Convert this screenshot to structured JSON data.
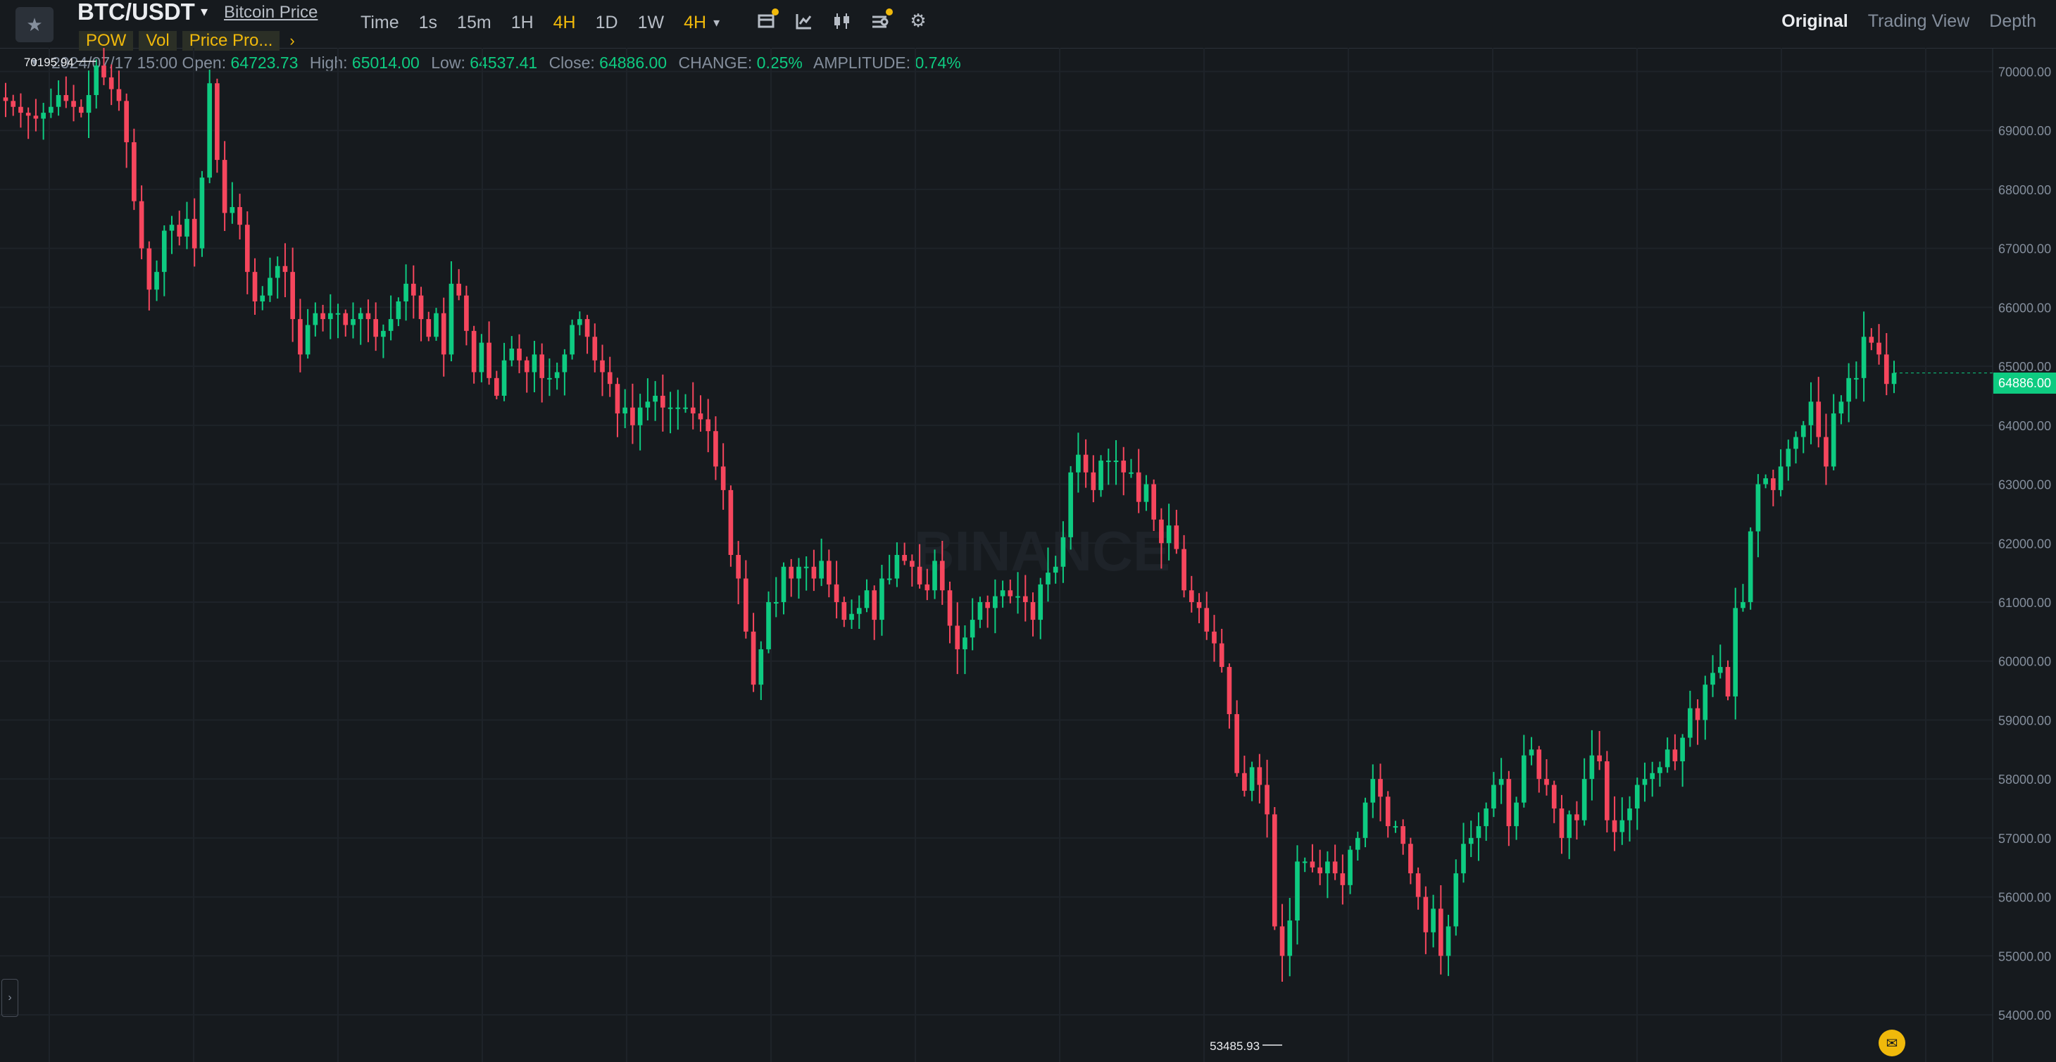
{
  "header": {
    "symbol": "BTC/USDT",
    "price_link": "Bitcoin Price",
    "indicators": [
      "POW",
      "Vol",
      "Price Pro..."
    ],
    "intervals": [
      {
        "label": "Time",
        "active": false
      },
      {
        "label": "1s",
        "active": false
      },
      {
        "label": "15m",
        "active": false
      },
      {
        "label": "1H",
        "active": false
      },
      {
        "label": "4H",
        "active": true
      },
      {
        "label": "1D",
        "active": false
      },
      {
        "label": "1W",
        "active": false
      },
      {
        "label": "4H",
        "active": true
      }
    ],
    "views": [
      "Original",
      "Trading View",
      "Depth"
    ],
    "active_view": "Original",
    "tool_icons": [
      "calendar-icon",
      "indicator-chart-icon",
      "candlestick-icon",
      "settings-list-icon",
      "gear-icon"
    ]
  },
  "ohlc": {
    "datetime": "2024/07/17 15:00",
    "open_label": "Open:",
    "open": "64723.73",
    "high_label": "High:",
    "high": "65014.00",
    "low_label": "Low:",
    "low": "64537.41",
    "close_label": "Close:",
    "close": "64886.00",
    "change_label": "CHANGE:",
    "change": "0.25%",
    "amplitude_label": "AMPLITUDE:",
    "amplitude": "0.74%"
  },
  "watermark": "BINANCE",
  "colors": {
    "up": "#0ecb81",
    "down": "#f6465d",
    "accent": "#f0b90b",
    "bg": "#161a1e"
  },
  "chart_data": {
    "type": "candlestick",
    "y_ticks": [
      "70000.00",
      "69000.00",
      "68000.00",
      "67000.00",
      "66000.00",
      "65000.00",
      "64000.00",
      "63000.00",
      "62000.00",
      "61000.00",
      "60000.00",
      "59000.00",
      "58000.00",
      "57000.00",
      "56000.00",
      "55000.00",
      "54000.00"
    ],
    "ylim": [
      53200,
      70400
    ],
    "current_price": "64886.00",
    "max_label": "70195.94",
    "min_label": "53485.93",
    "closes": [
      69500,
      69400,
      69300,
      69250,
      69200,
      69300,
      69400,
      69600,
      69500,
      69400,
      69300,
      69600,
      70100,
      69900,
      69700,
      69500,
      68800,
      67800,
      67000,
      66300,
      66600,
      67300,
      67400,
      67200,
      67500,
      67000,
      68200,
      69800,
      68500,
      67600,
      67700,
      67400,
      66600,
      66100,
      66200,
      66500,
      66700,
      66600,
      65800,
      65200,
      65700,
      65900,
      65800,
      65900,
      65900,
      65700,
      65800,
      65900,
      65800,
      65500,
      65600,
      65800,
      66100,
      66400,
      66200,
      65800,
      65500,
      65900,
      65200,
      66400,
      66200,
      65600,
      64900,
      65400,
      64800,
      64500,
      65100,
      65300,
      65100,
      64900,
      65200,
      64800,
      64800,
      64900,
      65200,
      65700,
      65800,
      65500,
      65100,
      64900,
      64700,
      64200,
      64300,
      64000,
      64300,
      64400,
      64500,
      64300,
      64300,
      64300,
      64300,
      64200,
      64100,
      63900,
      63300,
      62900,
      61800,
      61400,
      60500,
      59600,
      60200,
      61000,
      61000,
      61600,
      61400,
      61600,
      61600,
      61400,
      61700,
      61300,
      61000,
      60700,
      60800,
      60900,
      61200,
      60700,
      61400,
      61400,
      61800,
      61700,
      61600,
      61300,
      61200,
      61700,
      61200,
      60600,
      60200,
      60400,
      60700,
      61000,
      60900,
      61100,
      61200,
      61100,
      61100,
      61000,
      60700,
      61300,
      61500,
      61600,
      62100,
      63200,
      63500,
      63200,
      62900,
      63400,
      63400,
      63400,
      63200,
      63200,
      62700,
      63000,
      62400,
      62000,
      62300,
      61900,
      61200,
      61000,
      60900,
      60500,
      60300,
      59900,
      59100,
      58100,
      57800,
      58200,
      57900,
      57400,
      55500,
      55000,
      55600,
      56600,
      56600,
      56500,
      56400,
      56600,
      56400,
      56200,
      56800,
      57000,
      57600,
      58000,
      57700,
      57200,
      57200,
      56900,
      56400,
      56000,
      55400,
      55800,
      55000,
      55500,
      56400,
      56900,
      57000,
      57200,
      57500,
      57900,
      58000,
      57200,
      57600,
      58400,
      58500,
      58000,
      57900,
      57500,
      57000,
      57400,
      57300,
      58000,
      58400,
      58300,
      57300,
      57100,
      57300,
      57500,
      57900,
      58000,
      58100,
      58200,
      58500,
      58300,
      58700,
      59200,
      59000,
      59600,
      59800,
      59900,
      59400,
      60900,
      61000,
      62200,
      63000,
      63100,
      62900,
      63300,
      63600,
      63800,
      64000,
      64400,
      63800,
      63300,
      64200,
      64400,
      64800,
      64800,
      65500,
      65400,
      65200,
      64700,
      64886
    ]
  }
}
